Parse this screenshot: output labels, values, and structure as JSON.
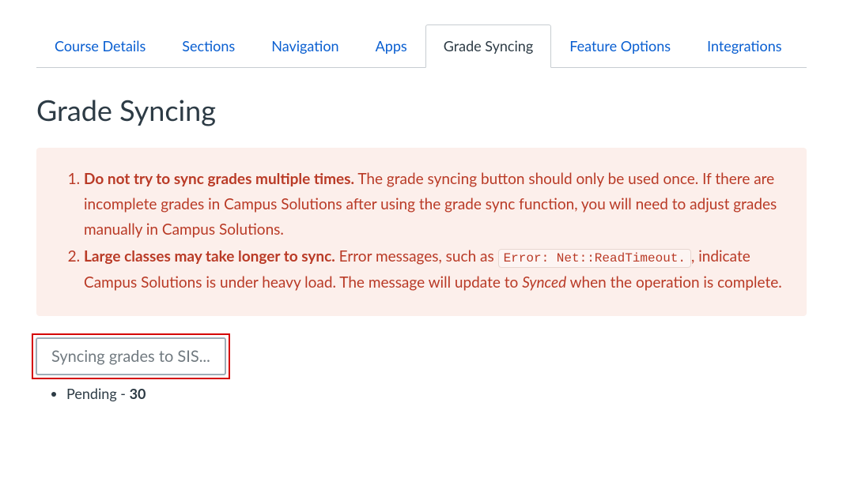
{
  "tabs": {
    "items": [
      {
        "label": "Course Details",
        "active": false
      },
      {
        "label": "Sections",
        "active": false
      },
      {
        "label": "Navigation",
        "active": false
      },
      {
        "label": "Apps",
        "active": false
      },
      {
        "label": "Grade Syncing",
        "active": true
      },
      {
        "label": "Feature Options",
        "active": false
      },
      {
        "label": "Integrations",
        "active": false
      }
    ]
  },
  "page": {
    "title": "Grade Syncing"
  },
  "alert": {
    "item1_strong": "Do not try to sync grades multiple times.",
    "item1_rest": " The grade syncing button should only be used once. If there are incomplete grades in Campus Solutions after using the grade sync function, you will need to adjust grades manually in Campus Solutions.",
    "item2_strong": "Large classes may take longer to sync.",
    "item2_before_code": " Error messages, such as ",
    "item2_code": "Error: Net::ReadTimeout.",
    "item2_after_code": ", indicate Campus Solutions is under heavy load. The message will update to ",
    "item2_em": "Synced",
    "item2_tail": " when the operation is complete."
  },
  "sync_button": {
    "label": "Syncing grades to SIS..."
  },
  "status": {
    "pending_label": "Pending - ",
    "pending_count": "30"
  }
}
